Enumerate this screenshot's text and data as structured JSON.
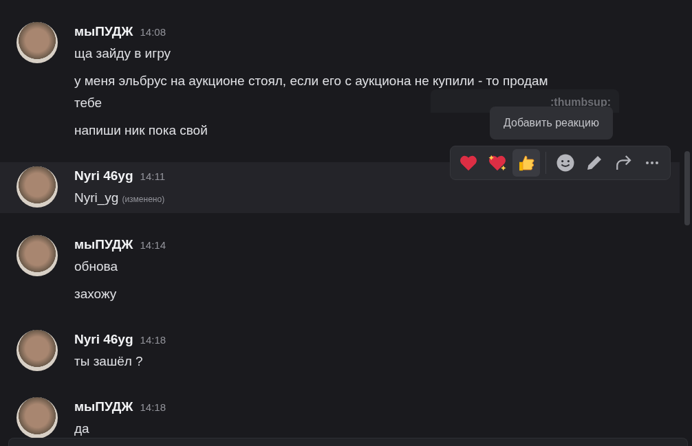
{
  "messages": [
    {
      "author": "мыПУДЖ",
      "time": "14:08",
      "hovered": false,
      "lines": [
        {
          "text": "ща зайду в игру"
        },
        {
          "text": "у меня эльбрус на аукционе стоял, если его с аукциона не купили - то продам тебе"
        },
        {
          "text": "напиши ник пока свой"
        }
      ]
    },
    {
      "author": "Nyri 46yg",
      "time": "14:11",
      "hovered": true,
      "lines": [
        {
          "text": "Nyri_yg",
          "edited": "(изменено)"
        }
      ]
    },
    {
      "author": "мыПУДЖ",
      "time": "14:14",
      "hovered": false,
      "lines": [
        {
          "text": "обнова"
        },
        {
          "text": "захожу"
        }
      ]
    },
    {
      "author": "Nyri 46yg",
      "time": "14:18",
      "hovered": false,
      "lines": [
        {
          "text": "ты зашёл ?"
        }
      ]
    },
    {
      "author": "мыПУДЖ",
      "time": "14:18",
      "hovered": false,
      "lines": [
        {
          "text": "да"
        }
      ]
    }
  ],
  "action_bar": {
    "reactions": [
      {
        "kind": "heart",
        "hovered": false
      },
      {
        "kind": "sparkling-heart",
        "hovered": false
      },
      {
        "kind": "thumbs-up",
        "hovered": true
      }
    ],
    "tools": [
      {
        "kind": "smiley"
      },
      {
        "kind": "pencil"
      },
      {
        "kind": "reply-arrow"
      },
      {
        "kind": "more"
      }
    ]
  },
  "faded_tooltip": {
    "title": ":thumbsup:"
  },
  "tooltip": {
    "text": "Добавить реакцию"
  }
}
